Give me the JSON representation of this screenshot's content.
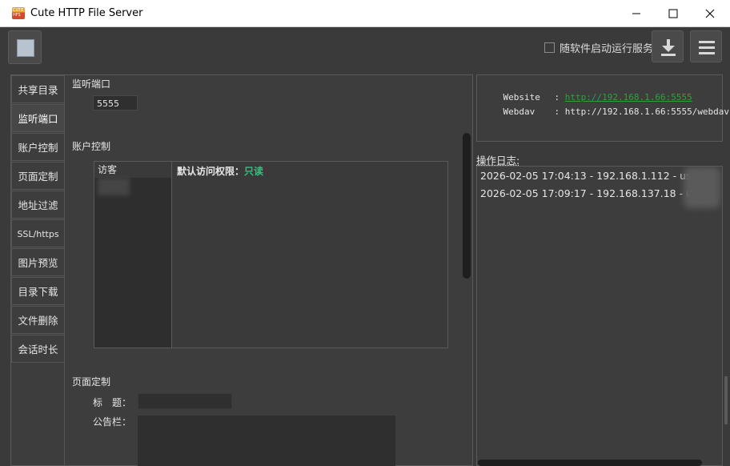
{
  "window": {
    "title": "Cute HTTP File Server",
    "icon_text": "CUTE HFS",
    "minimize": "minimize",
    "maximize": "maximize",
    "close": "close"
  },
  "toolbar": {
    "autostart_label": "随软件启动运行服务",
    "autostart_checked": false
  },
  "sidebar": {
    "items": [
      {
        "label": "共享目录",
        "active": false
      },
      {
        "label": "监听端口",
        "active": true
      },
      {
        "label": "账户控制",
        "active": false
      },
      {
        "label": "页面定制",
        "active": false
      },
      {
        "label": "地址过滤",
        "active": false
      },
      {
        "label": "SSL/https",
        "active": false
      },
      {
        "label": "图片预览",
        "active": false
      },
      {
        "label": "目录下载",
        "active": false
      },
      {
        "label": "文件删除",
        "active": false
      },
      {
        "label": "会话时长",
        "active": false
      }
    ]
  },
  "settings": {
    "port_section": "监听端口",
    "port_value": "5555",
    "account_section": "账户控制",
    "account_list_header": "访客",
    "default_permission_label": "默认访问权限：",
    "default_permission_value": "只读",
    "page_section": "页面定制",
    "title_label": "标　题：",
    "notice_label": "公告栏："
  },
  "urls": {
    "website_key": "Website",
    "website_value": "http://192.168.1.66:5555",
    "webdav_key": "Webdav",
    "webdav_value": "http://192.168.1.66:5555/webdav",
    "separator": ": "
  },
  "log": {
    "label": "操作日志:",
    "lines": [
      "2026-02-05 17:04:13 - 192.168.1.112 - user",
      "2026-02-05 17:09:17 - 192.168.137.18 - user"
    ]
  },
  "colors": {
    "background": "#3a3a3a",
    "accent_green": "#2ec27e",
    "link_green": "#2ea043"
  }
}
